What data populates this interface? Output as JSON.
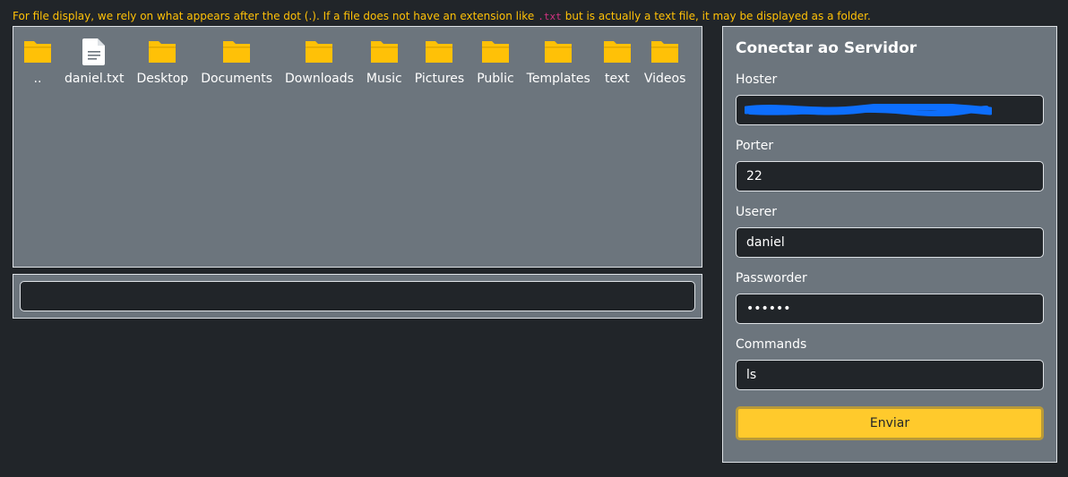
{
  "notice": {
    "text_before": "For file display, we rely on what appears after the dot (.). If a file does not have an extension like",
    "code": ".txt",
    "text_after": "but is actually a text file, it may be displayed as a folder."
  },
  "files": [
    {
      "name": "..",
      "icon": "folder-icon"
    },
    {
      "name": "daniel.txt",
      "icon": "text-file-icon"
    },
    {
      "name": "Desktop",
      "icon": "folder-icon"
    },
    {
      "name": "Documents",
      "icon": "folder-icon"
    },
    {
      "name": "Downloads",
      "icon": "folder-icon"
    },
    {
      "name": "Music",
      "icon": "folder-icon"
    },
    {
      "name": "Pictures",
      "icon": "folder-icon"
    },
    {
      "name": "Public",
      "icon": "folder-icon"
    },
    {
      "name": "Templates",
      "icon": "folder-icon"
    },
    {
      "name": "text",
      "icon": "folder-icon"
    },
    {
      "name": "Videos",
      "icon": "folder-icon"
    }
  ],
  "output": {
    "value": ""
  },
  "connection": {
    "title": "Conectar ao Servidor",
    "host_label": "Hoster",
    "host_value": "",
    "port_label": "Porter",
    "port_value": "22",
    "user_label": "Userer",
    "user_value": "daniel",
    "password_label": "Passworder",
    "password_value": "secret",
    "command_label": "Commands",
    "command_value": "ls",
    "submit_label": "Enviar"
  },
  "colors": {
    "background": "#212529",
    "panel": "#6c757d",
    "accent": "#ffc107",
    "code": "#d63384",
    "folder": "#ffc107",
    "redaction": "#0d6efd"
  }
}
